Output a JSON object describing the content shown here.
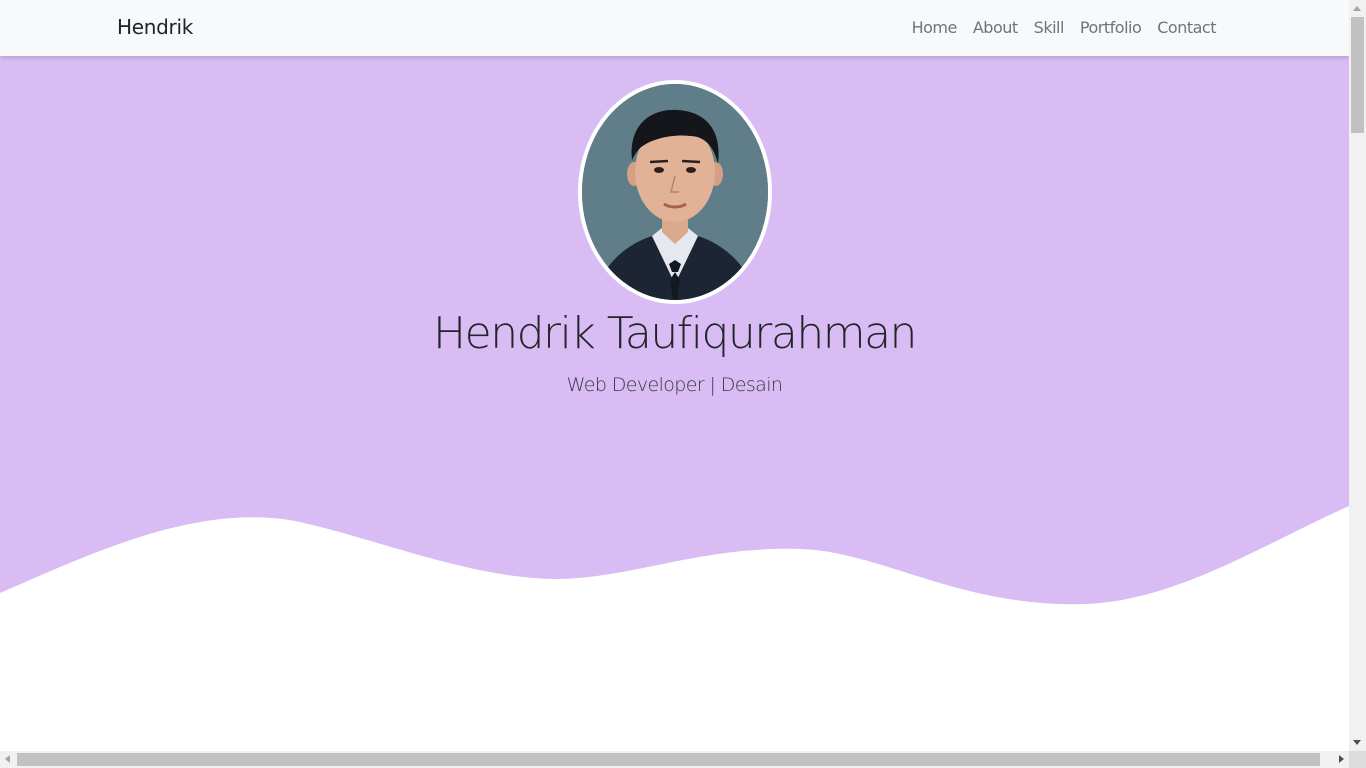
{
  "navbar": {
    "brand": "Hendrik",
    "links": [
      {
        "label": "Home"
      },
      {
        "label": "About"
      },
      {
        "label": "Skill"
      },
      {
        "label": "Portfolio"
      },
      {
        "label": "Contact"
      }
    ]
  },
  "hero": {
    "name": "Hendrik Taufiqurahman",
    "tagline": "Web Developer | Desain",
    "photo_alt": "Profile photo"
  },
  "colors": {
    "hero_background": "#dabcf5",
    "navbar_background": "#f8f9fa",
    "page_background": "#ffffff"
  }
}
